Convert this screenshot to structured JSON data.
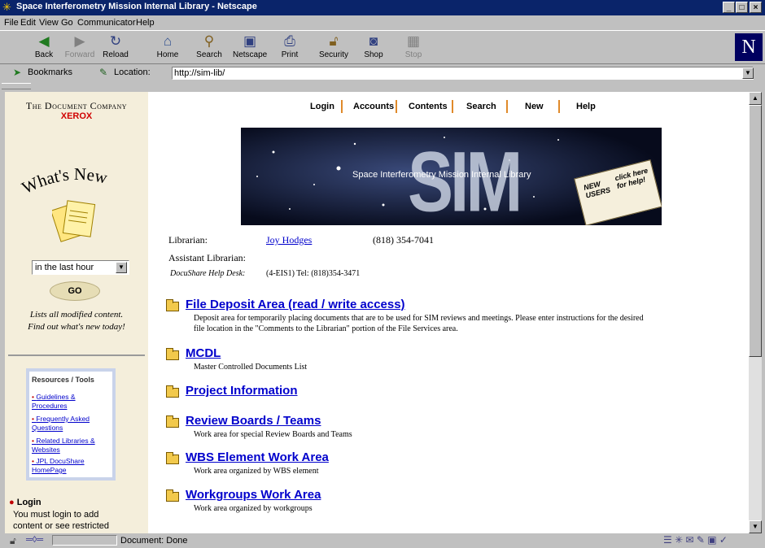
{
  "window": {
    "title": "Space Interferometry Mission Internal Library - Netscape",
    "btn_min": "_",
    "btn_max": "□",
    "btn_close": "×"
  },
  "menu": [
    "File",
    "Edit",
    "View",
    "Go",
    "Communicator",
    "Help"
  ],
  "toolbar": {
    "back": "Back",
    "forward": "Forward",
    "reload": "Reload",
    "home": "Home",
    "search": "Search",
    "netscape": "Netscape",
    "print": "Print",
    "security": "Security",
    "shop": "Shop",
    "stop": "Stop",
    "logo": "N"
  },
  "location": {
    "bookmarks": "Bookmarks",
    "label": "Location:",
    "url": "http://sim-lib/"
  },
  "sidebar": {
    "company": "The Document Company",
    "brand": "XEROX",
    "whats_new": "What's New",
    "period_select": "in the last hour",
    "go_button": "GO",
    "modified_line1": "Lists all modified content.",
    "modified_line2": "Find out what's new today!",
    "resources_title": "Resources / Tools",
    "resources": [
      "Guidelines & Procedures",
      "Frequently Asked Questions",
      "Related Libraries & Websites",
      "JPL DocuShare HomePage"
    ],
    "login_title": "Login",
    "login_text_1": "You must login to add",
    "login_text_2": "content or see restricted"
  },
  "nav": [
    "Login",
    "Accounts",
    "Contents",
    "Search",
    "New",
    "Help"
  ],
  "banner": {
    "sim": "SIM",
    "caption": "Space Interferometry Mission Internal Library",
    "new_users": "NEW USERS",
    "click_help": "click here for help!"
  },
  "contacts": {
    "librarian_label": "Librarian:",
    "librarian_name": "Joy Hodges",
    "librarian_phone": "(818) 354-7041",
    "assistant_label": "Assistant Librarian:",
    "helpdesk_label": "DocuShare Help Desk:",
    "helpdesk_info": "(4-EIS1) Tel: (818)354-3471"
  },
  "folders": [
    {
      "title": "File Deposit Area (read / write access)",
      "desc_1": "Deposit area for temporarily placing documents that are to be used for SIM reviews and meetings. Please enter instructions for the desired",
      "desc_2": "file location in the \"Comments to the Librarian\" portion of the File Services area."
    },
    {
      "title": "MCDL",
      "desc_1": "Master Controlled Documents List"
    },
    {
      "title": "Project Information"
    },
    {
      "title": "Review Boards / Teams",
      "desc_1": "Work area for special Review Boards and Teams"
    },
    {
      "title": "WBS Element Work Area",
      "desc_1": "Work area organized by WBS element"
    },
    {
      "title": "Workgroups Work Area",
      "desc_1": "Work area organized by workgroups"
    }
  ],
  "status": {
    "text": "Document: Done"
  }
}
